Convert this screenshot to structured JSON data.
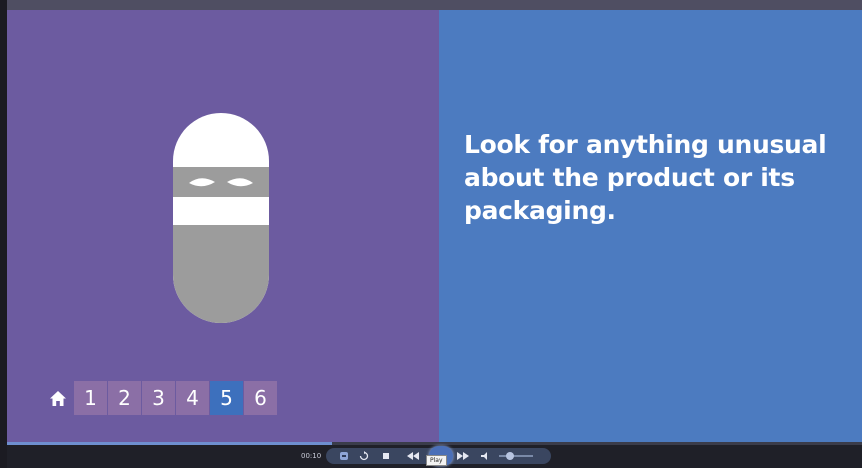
{
  "slide": {
    "headline": "Look for anything unusual about the product or its packaging.",
    "colors": {
      "left_panel": "#6c5ba0",
      "right_panel": "#4c7bc0",
      "nav_page": "#8b6fa6",
      "nav_active": "#3d70bd"
    }
  },
  "nav": {
    "home_icon": "home-icon",
    "pages": [
      "1",
      "2",
      "3",
      "4",
      "5",
      "6"
    ],
    "active_page": "5"
  },
  "player": {
    "time": "00:10",
    "progress": 0.38,
    "tooltip": "Play",
    "volume": 0.3
  }
}
